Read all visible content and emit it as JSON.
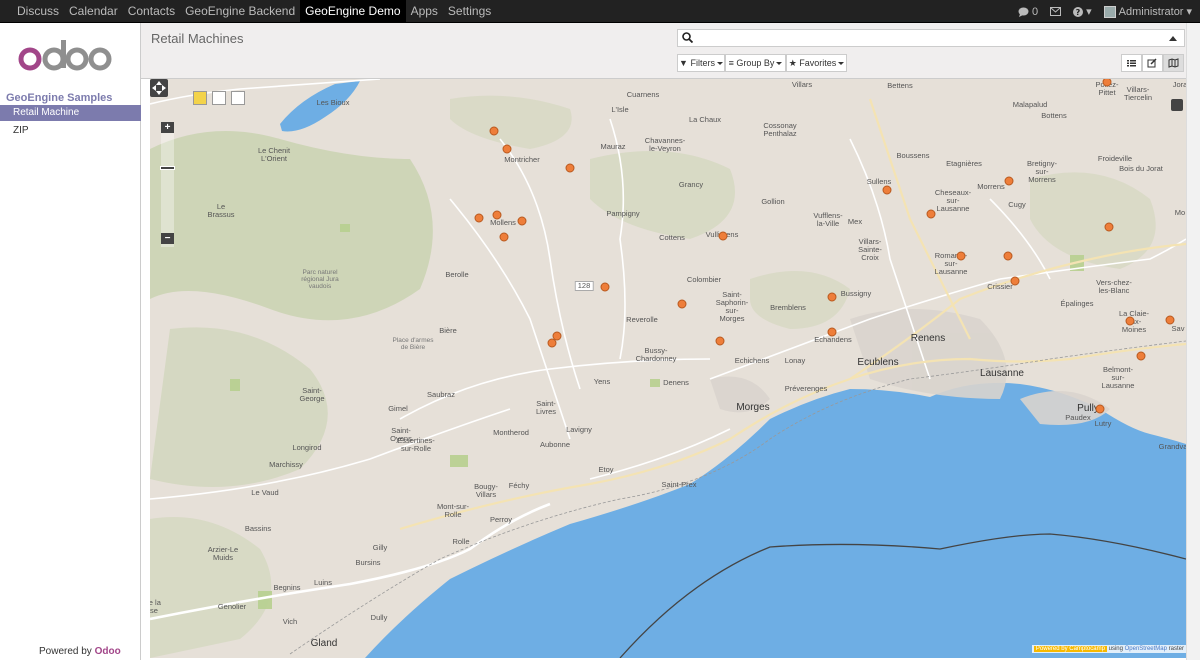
{
  "topbar": {
    "nav": [
      "Discuss",
      "Calendar",
      "Contacts",
      "GeoEngine Backend",
      "GeoEngine Demo",
      "Apps",
      "Settings"
    ],
    "active_index": 4,
    "messages_count": "0",
    "user": "Administrator"
  },
  "sidebar": {
    "logo": "odoo",
    "section": "GeoEngine Samples",
    "items": [
      {
        "label": "Retail Machine",
        "active": true
      },
      {
        "label": "ZIP",
        "active": false
      }
    ],
    "powered_by": "Powered by",
    "powered_brand": "Odoo"
  },
  "controlpanel": {
    "title": "Retail Machines",
    "search_value": "",
    "filters_label": "Filters",
    "groupby_label": "Group By",
    "favorites_label": "Favorites"
  },
  "map": {
    "attribution_powered": "Powered by Camptocamp",
    "attribution_using": "using",
    "attribution_osm": "OpenStreetMap",
    "attribution_suffix": "raster",
    "road_label": "128",
    "labels": [
      "Villars",
      "Bettens",
      "Poliez-\nPittet",
      "Villars-\nTiercelin",
      "Jora",
      "Cuarnens",
      "La Chaux",
      "Cossonay\nPenthalaz",
      "Malapalud",
      "Bottens",
      "Les Bioux",
      "L'Isle",
      "Mauraz",
      "Chavannes-\nle-Veyron",
      "Montricher",
      "Boussens",
      "Etagnières",
      "Bretigny-\nsur-\nMorrens",
      "Froideville",
      "Bois du Jorat",
      "Le Chenit\nL'Orient",
      "Sullens",
      "Cheseaux-\nsur-\nLausanne",
      "Morrens",
      "Cugy",
      "Le\nBrassus",
      "Grancy",
      "Gollion",
      "Vufflens-\nla-Ville",
      "Mex",
      "Mollens",
      "Pampigny",
      "Cottens",
      "Vullierens",
      "Villars-\nSainte-\nCroix",
      "Romanel-\nsur-\nLausanne",
      "Parc naturel\nrégional Jura\nvaudois",
      "Berolle",
      "Colombier",
      "Crissier",
      "Vers-chez-\nles-Blanc",
      "Saint-\nSaphorin-\nsur-\nMorges",
      "Bussigny",
      "Épalinges",
      "Reverolle",
      "Bremblens",
      "La Claie-\naux-\nMoines",
      "Sav",
      "Bière",
      "Place d'armes\nde Bière",
      "Echandens",
      "Bussy-\nChardonney",
      "Echichens",
      "Lonay",
      "Ecublens",
      "Renens",
      "Lausanne",
      "Belmont-\nsur-\nLausanne",
      "Yens",
      "Denens",
      "Préverenges",
      "Saint-\nGeorge",
      "Saubraz",
      "Saint-\nLivres",
      "Gimel",
      "Morges",
      "Pully",
      "Paudex",
      "Lutry",
      "Saint-\nOyens",
      "Essertines-\nsur-Rolle",
      "Montherod",
      "Lavigny",
      "Aubonne",
      "Longirod",
      "Grandvaux",
      "Marchissy",
      "Etoy",
      "Le Vaud",
      "Bougy-\nVillars",
      "Féchy",
      "Saint-Prex",
      "Mont-sur-\nRolle",
      "Perroy",
      "Bassins",
      "Rolle",
      "Gilly",
      "Arzier-Le\nMuids",
      "Bursins",
      "Begnins",
      "Luins",
      "Genolier",
      "Vich",
      "Dully",
      "Gland",
      "Mo",
      "le la\nse"
    ],
    "markers": 30
  }
}
